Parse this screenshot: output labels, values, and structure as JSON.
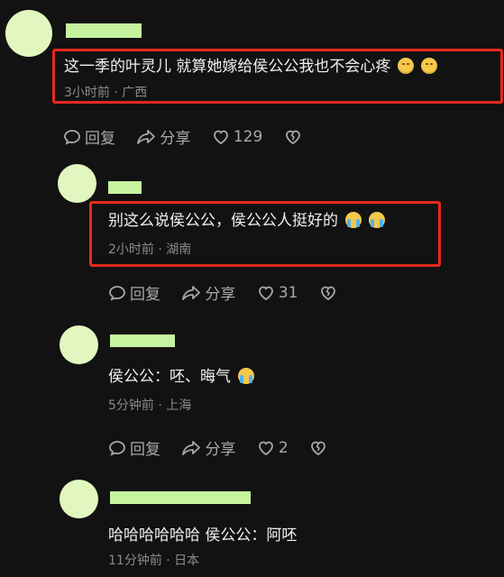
{
  "comments": [
    {
      "text": "这一季的叶灵儿 就算她嫁给侯公公我也不会心疼",
      "emojis": [
        "smile",
        "smile"
      ],
      "meta": "3小时前 · 广西",
      "reply_label": "回复",
      "share_label": "分享",
      "likes": "129"
    },
    {
      "text": "别这么说侯公公，侯公公人挺好的",
      "emojis": [
        "cry",
        "cry"
      ],
      "meta": "2小时前 · 湖南",
      "reply_label": "回复",
      "share_label": "分享",
      "likes": "31"
    },
    {
      "text": "侯公公：呸、晦气",
      "emojis": [
        "cry"
      ],
      "meta": "5分钟前 · 上海",
      "reply_label": "回复",
      "share_label": "分享",
      "likes": "2"
    },
    {
      "text": "哈哈哈哈哈哈 侯公公：阿呸",
      "emojis": [],
      "meta": "11分钟前 · 日本",
      "reply_label": "",
      "share_label": "",
      "likes": ""
    }
  ],
  "colors": {
    "background": "#121212",
    "highlight": "#e8281e",
    "avatar": "#e2f7bf",
    "name_bar": "#c6f3a0"
  },
  "icons": [
    "reply-icon",
    "share-icon",
    "heart-icon",
    "broken-heart-icon"
  ]
}
